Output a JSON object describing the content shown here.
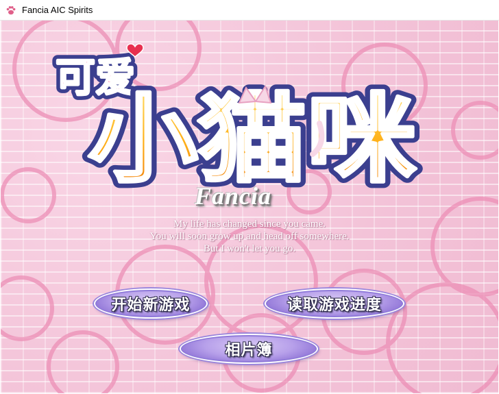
{
  "window": {
    "title": "Fancia AIC Spirits",
    "icon": "paw-icon"
  },
  "logo": {
    "line1": "可爱",
    "line2": "小猫咪"
  },
  "brand": "Fancia",
  "poem": [
    "My life has changed since you came.",
    "You will soon grow up and head off somewhere.",
    "But I won't let you go."
  ],
  "menu": {
    "new_game": "开始新游戏",
    "load_game": "读取游戏进度",
    "album": "相片簿"
  },
  "colors": {
    "background": "#f5c8dc",
    "logo_fill": "#ffb21a",
    "logo_outline": "#3b3f8f",
    "button": "#b7a0ea"
  }
}
